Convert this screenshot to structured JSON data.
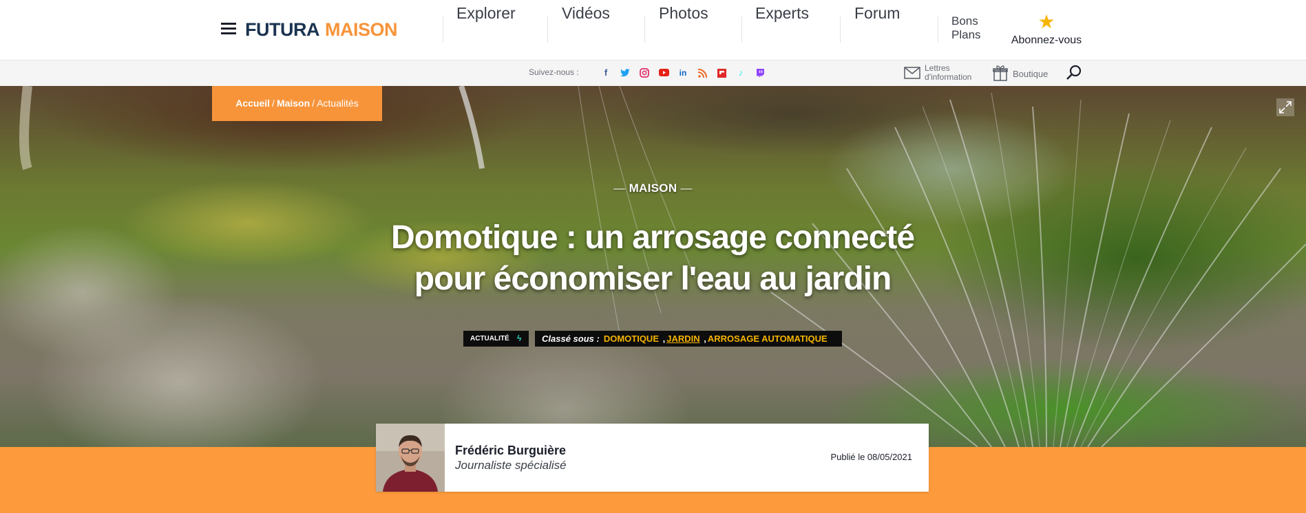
{
  "header": {
    "logo_part1": "FUTURA",
    "logo_part2": "MAISON",
    "nav": [
      "Explorer",
      "Vidéos",
      "Photos",
      "Experts",
      "Forum"
    ],
    "bons_line1": "Bons",
    "bons_line2": "Plans",
    "subscribe_label": "Abonnez-vous"
  },
  "subbar": {
    "follow_label": "Suivez-nous :",
    "social_icons": [
      "facebook-icon",
      "twitter-icon",
      "instagram-icon",
      "youtube-icon",
      "linkedin-icon",
      "rss-icon",
      "flipboard-icon",
      "tiktok-icon",
      "twitch-icon"
    ],
    "lettres_line1": "Lettres",
    "lettres_line2": "d'information",
    "boutique_label": "Boutique"
  },
  "breadcrumb": {
    "home": "Accueil",
    "section": "Maison",
    "current": "Actualités"
  },
  "article": {
    "kicker": "MAISON",
    "title_line1": "Domotique : un arrosage connecté",
    "title_line2": "pour économiser l'eau au jardin",
    "type_badge": "ACTUALITÉ",
    "classified_label": "Classé sous :",
    "tags": [
      "DOMOTIQUE",
      "JARDIN",
      "ARROSAGE AUTOMATIQUE"
    ]
  },
  "author": {
    "name": "Frédéric Burguière",
    "role": "Journaliste spécialisé",
    "published": "Publié le 08/05/2021"
  },
  "colors": {
    "brand_orange": "#f7943a",
    "band_orange": "#fd9a3c",
    "logo_navy": "#1b3350",
    "tag_yellow": "#f7b500"
  }
}
